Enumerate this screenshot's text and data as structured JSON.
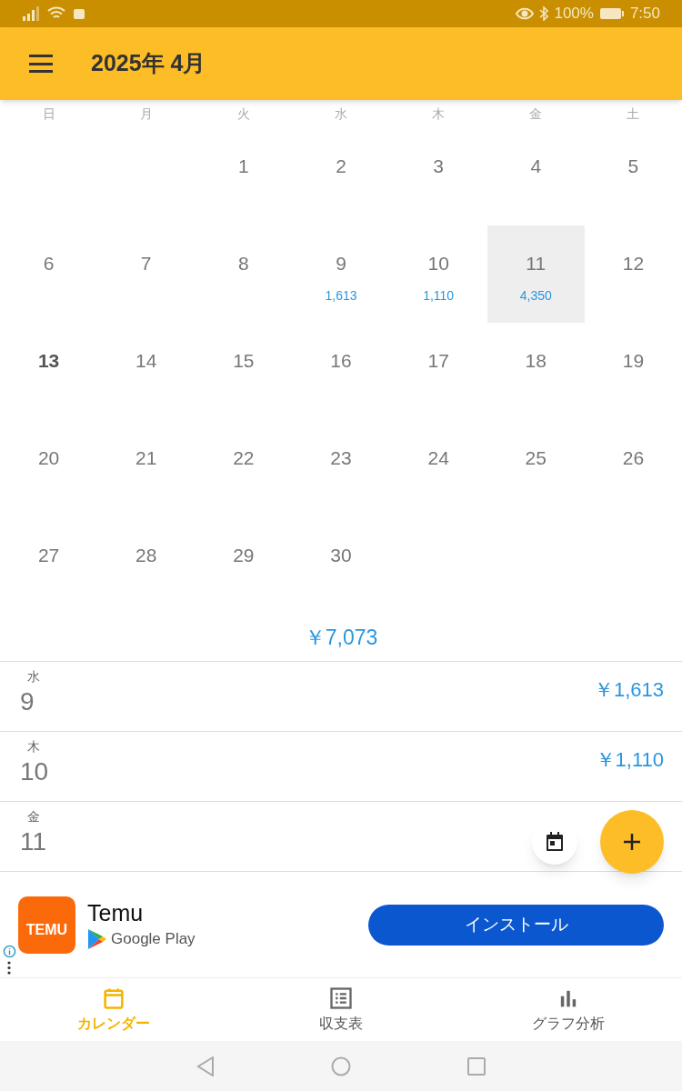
{
  "status_bar": {
    "battery": "100%",
    "time": "7:50"
  },
  "app_bar": {
    "title": "2025年 4月"
  },
  "calendar": {
    "weekdays": [
      "日",
      "月",
      "火",
      "水",
      "木",
      "金",
      "土"
    ],
    "weeks": [
      [
        {
          "kind": "blank"
        },
        {
          "kind": "blank"
        },
        {
          "kind": "day",
          "day": "1",
          "today": false,
          "selected": false
        },
        {
          "kind": "day",
          "day": "2",
          "today": false,
          "selected": false
        },
        {
          "kind": "day",
          "day": "3",
          "today": false,
          "selected": false
        },
        {
          "kind": "day",
          "day": "4",
          "today": false,
          "selected": false
        },
        {
          "kind": "day",
          "day": "5",
          "today": false,
          "selected": false
        }
      ],
      [
        {
          "kind": "day",
          "day": "6",
          "today": false,
          "selected": false
        },
        {
          "kind": "day",
          "day": "7",
          "today": false,
          "selected": false
        },
        {
          "kind": "day",
          "day": "8",
          "today": false,
          "selected": false
        },
        {
          "kind": "day",
          "day": "9",
          "amount": "1,613",
          "today": false,
          "selected": false
        },
        {
          "kind": "day",
          "day": "10",
          "amount": "1,110",
          "today": false,
          "selected": false
        },
        {
          "kind": "day",
          "day": "11",
          "amount": "4,350",
          "today": false,
          "selected": true
        },
        {
          "kind": "day",
          "day": "12",
          "today": false,
          "selected": false
        }
      ],
      [
        {
          "kind": "day",
          "day": "13",
          "today": true,
          "selected": false
        },
        {
          "kind": "day",
          "day": "14",
          "today": false,
          "selected": false
        },
        {
          "kind": "day",
          "day": "15",
          "today": false,
          "selected": false
        },
        {
          "kind": "day",
          "day": "16",
          "today": false,
          "selected": false
        },
        {
          "kind": "day",
          "day": "17",
          "today": false,
          "selected": false
        },
        {
          "kind": "day",
          "day": "18",
          "today": false,
          "selected": false
        },
        {
          "kind": "day",
          "day": "19",
          "today": false,
          "selected": false
        }
      ],
      [
        {
          "kind": "day",
          "day": "20",
          "today": false,
          "selected": false
        },
        {
          "kind": "day",
          "day": "21",
          "today": false,
          "selected": false
        },
        {
          "kind": "day",
          "day": "22",
          "today": false,
          "selected": false
        },
        {
          "kind": "day",
          "day": "23",
          "today": false,
          "selected": false
        },
        {
          "kind": "day",
          "day": "24",
          "today": false,
          "selected": false
        },
        {
          "kind": "day",
          "day": "25",
          "today": false,
          "selected": false
        },
        {
          "kind": "day",
          "day": "26",
          "today": false,
          "selected": false
        }
      ],
      [
        {
          "kind": "day",
          "day": "27",
          "today": false,
          "selected": false
        },
        {
          "kind": "day",
          "day": "28",
          "today": false,
          "selected": false
        },
        {
          "kind": "day",
          "day": "29",
          "today": false,
          "selected": false
        },
        {
          "kind": "day",
          "day": "30",
          "today": false,
          "selected": false
        },
        {
          "kind": "blank"
        },
        {
          "kind": "blank"
        },
        {
          "kind": "blank"
        }
      ]
    ],
    "total": "￥7,073"
  },
  "entries": [
    {
      "weekday": "水",
      "day": "9",
      "amount": "￥1,613"
    },
    {
      "weekday": "木",
      "day": "10",
      "amount": "￥1,110"
    },
    {
      "weekday": "金",
      "day": "11"
    }
  ],
  "ad": {
    "logo_text": "TEMU",
    "name": "Temu",
    "store": "Google Play",
    "button": "インストール"
  },
  "bottom_nav": [
    {
      "kind": "calendar",
      "label": "カレンダー",
      "selected": true
    },
    {
      "kind": "table",
      "label": "収支表",
      "selected": false
    },
    {
      "kind": "chart",
      "label": "グラフ分析",
      "selected": false
    }
  ]
}
